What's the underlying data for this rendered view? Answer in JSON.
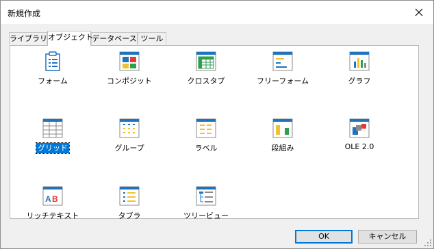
{
  "window": {
    "title": "新規作成"
  },
  "tabs": [
    "ライブラリ",
    "オブジェクト",
    "データベース",
    "ツール"
  ],
  "active_tab": "オブジェクト",
  "items": [
    {
      "label": "フォーム",
      "icon": "form-icon",
      "selected": false
    },
    {
      "label": "コンポジット",
      "icon": "composite-icon",
      "selected": false
    },
    {
      "label": "クロスタブ",
      "icon": "crosstab-icon",
      "selected": false
    },
    {
      "label": "フリーフォーム",
      "icon": "freeform-icon",
      "selected": false
    },
    {
      "label": "グラフ",
      "icon": "graph-icon",
      "selected": false
    },
    {
      "label": "グリッド",
      "icon": "grid-icon",
      "selected": true
    },
    {
      "label": "グループ",
      "icon": "group-icon",
      "selected": false
    },
    {
      "label": "ラベル",
      "icon": "label-icon",
      "selected": false
    },
    {
      "label": "段組み",
      "icon": "n-up-icon",
      "selected": false
    },
    {
      "label": "OLE 2.0",
      "icon": "ole-icon",
      "selected": false
    },
    {
      "label": "リッチテキスト",
      "icon": "richtext-icon",
      "selected": false
    },
    {
      "label": "タブラ",
      "icon": "tabular-icon",
      "selected": false
    },
    {
      "label": "ツリービュー",
      "icon": "treeview-icon",
      "selected": false
    }
  ],
  "icon_text": {
    "richtext": "AB"
  },
  "buttons": {
    "ok": "OK",
    "cancel": "キャンセル"
  },
  "colors": {
    "accent_blue": "#1e73be",
    "selection": "#0078d7"
  }
}
